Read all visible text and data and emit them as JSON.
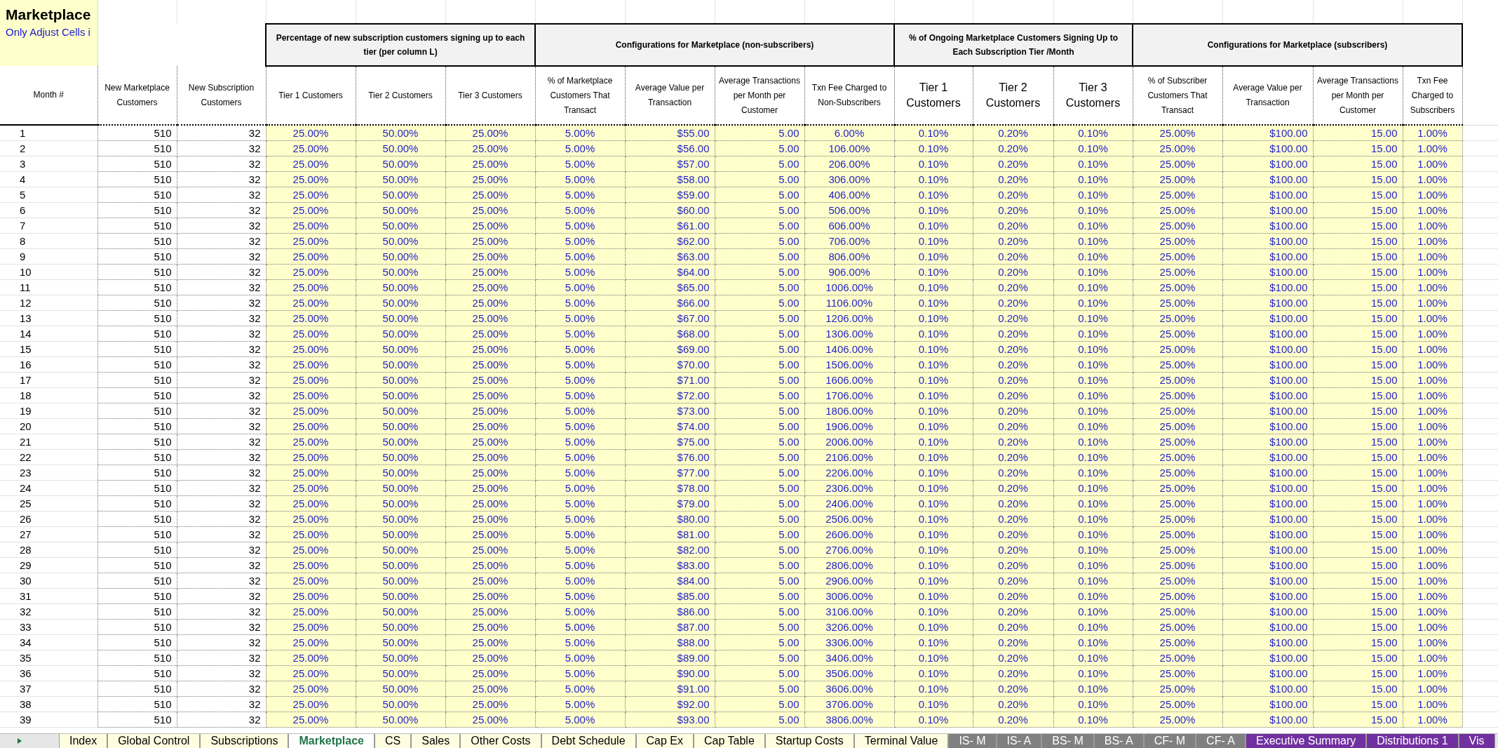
{
  "sheet": {
    "title": "Marketplace",
    "note": "Only Adjust Cells i"
  },
  "group_headers": [
    {
      "label": "Percentage of new subscription customers signing up to each tier (per column L)"
    },
    {
      "label": "Configurations for Marketplace (non-subscribers)"
    },
    {
      "label": "% of Ongoing Marketplace Customers Signing Up to Each Subscription Tier /Month"
    },
    {
      "label": "Configurations for Marketplace (subscribers)"
    }
  ],
  "columns": [
    "Month #",
    "New Marketplace Customers",
    "New Subscription Customers",
    "Tier 1 Customers",
    "Tier 2 Customers",
    "Tier 3 Customers",
    "% of Marketplace Customers That Transact",
    "Average Value per Transaction",
    "Average Transactions per Month per Customer",
    "Txn Fee Charged to Non-Subscribers",
    "Tier 1 Customers",
    "Tier 2 Customers",
    "Tier 3 Customers",
    "% of Subscriber Customers That Transact",
    "Average Value per Transaction",
    "Average Transactions per Month per Customer",
    "Txn Fee Charged to Subscribers"
  ],
  "rows": [
    [
      "1",
      "510",
      "32",
      "25.00%",
      "50.00%",
      "25.00%",
      "5.00%",
      "$55.00",
      "5.00",
      "6.00%",
      "0.10%",
      "0.20%",
      "0.10%",
      "25.00%",
      "$100.00",
      "15.00",
      "1.00%"
    ],
    [
      "2",
      "510",
      "32",
      "25.00%",
      "50.00%",
      "25.00%",
      "5.00%",
      "$56.00",
      "5.00",
      "106.00%",
      "0.10%",
      "0.20%",
      "0.10%",
      "25.00%",
      "$100.00",
      "15.00",
      "1.00%"
    ],
    [
      "3",
      "510",
      "32",
      "25.00%",
      "50.00%",
      "25.00%",
      "5.00%",
      "$57.00",
      "5.00",
      "206.00%",
      "0.10%",
      "0.20%",
      "0.10%",
      "25.00%",
      "$100.00",
      "15.00",
      "1.00%"
    ],
    [
      "4",
      "510",
      "32",
      "25.00%",
      "50.00%",
      "25.00%",
      "5.00%",
      "$58.00",
      "5.00",
      "306.00%",
      "0.10%",
      "0.20%",
      "0.10%",
      "25.00%",
      "$100.00",
      "15.00",
      "1.00%"
    ],
    [
      "5",
      "510",
      "32",
      "25.00%",
      "50.00%",
      "25.00%",
      "5.00%",
      "$59.00",
      "5.00",
      "406.00%",
      "0.10%",
      "0.20%",
      "0.10%",
      "25.00%",
      "$100.00",
      "15.00",
      "1.00%"
    ],
    [
      "6",
      "510",
      "32",
      "25.00%",
      "50.00%",
      "25.00%",
      "5.00%",
      "$60.00",
      "5.00",
      "506.00%",
      "0.10%",
      "0.20%",
      "0.10%",
      "25.00%",
      "$100.00",
      "15.00",
      "1.00%"
    ],
    [
      "7",
      "510",
      "32",
      "25.00%",
      "50.00%",
      "25.00%",
      "5.00%",
      "$61.00",
      "5.00",
      "606.00%",
      "0.10%",
      "0.20%",
      "0.10%",
      "25.00%",
      "$100.00",
      "15.00",
      "1.00%"
    ],
    [
      "8",
      "510",
      "32",
      "25.00%",
      "50.00%",
      "25.00%",
      "5.00%",
      "$62.00",
      "5.00",
      "706.00%",
      "0.10%",
      "0.20%",
      "0.10%",
      "25.00%",
      "$100.00",
      "15.00",
      "1.00%"
    ],
    [
      "9",
      "510",
      "32",
      "25.00%",
      "50.00%",
      "25.00%",
      "5.00%",
      "$63.00",
      "5.00",
      "806.00%",
      "0.10%",
      "0.20%",
      "0.10%",
      "25.00%",
      "$100.00",
      "15.00",
      "1.00%"
    ],
    [
      "10",
      "510",
      "32",
      "25.00%",
      "50.00%",
      "25.00%",
      "5.00%",
      "$64.00",
      "5.00",
      "906.00%",
      "0.10%",
      "0.20%",
      "0.10%",
      "25.00%",
      "$100.00",
      "15.00",
      "1.00%"
    ],
    [
      "11",
      "510",
      "32",
      "25.00%",
      "50.00%",
      "25.00%",
      "5.00%",
      "$65.00",
      "5.00",
      "1006.00%",
      "0.10%",
      "0.20%",
      "0.10%",
      "25.00%",
      "$100.00",
      "15.00",
      "1.00%"
    ],
    [
      "12",
      "510",
      "32",
      "25.00%",
      "50.00%",
      "25.00%",
      "5.00%",
      "$66.00",
      "5.00",
      "1106.00%",
      "0.10%",
      "0.20%",
      "0.10%",
      "25.00%",
      "$100.00",
      "15.00",
      "1.00%"
    ],
    [
      "13",
      "510",
      "32",
      "25.00%",
      "50.00%",
      "25.00%",
      "5.00%",
      "$67.00",
      "5.00",
      "1206.00%",
      "0.10%",
      "0.20%",
      "0.10%",
      "25.00%",
      "$100.00",
      "15.00",
      "1.00%"
    ],
    [
      "14",
      "510",
      "32",
      "25.00%",
      "50.00%",
      "25.00%",
      "5.00%",
      "$68.00",
      "5.00",
      "1306.00%",
      "0.10%",
      "0.20%",
      "0.10%",
      "25.00%",
      "$100.00",
      "15.00",
      "1.00%"
    ],
    [
      "15",
      "510",
      "32",
      "25.00%",
      "50.00%",
      "25.00%",
      "5.00%",
      "$69.00",
      "5.00",
      "1406.00%",
      "0.10%",
      "0.20%",
      "0.10%",
      "25.00%",
      "$100.00",
      "15.00",
      "1.00%"
    ],
    [
      "16",
      "510",
      "32",
      "25.00%",
      "50.00%",
      "25.00%",
      "5.00%",
      "$70.00",
      "5.00",
      "1506.00%",
      "0.10%",
      "0.20%",
      "0.10%",
      "25.00%",
      "$100.00",
      "15.00",
      "1.00%"
    ],
    [
      "17",
      "510",
      "32",
      "25.00%",
      "50.00%",
      "25.00%",
      "5.00%",
      "$71.00",
      "5.00",
      "1606.00%",
      "0.10%",
      "0.20%",
      "0.10%",
      "25.00%",
      "$100.00",
      "15.00",
      "1.00%"
    ],
    [
      "18",
      "510",
      "32",
      "25.00%",
      "50.00%",
      "25.00%",
      "5.00%",
      "$72.00",
      "5.00",
      "1706.00%",
      "0.10%",
      "0.20%",
      "0.10%",
      "25.00%",
      "$100.00",
      "15.00",
      "1.00%"
    ],
    [
      "19",
      "510",
      "32",
      "25.00%",
      "50.00%",
      "25.00%",
      "5.00%",
      "$73.00",
      "5.00",
      "1806.00%",
      "0.10%",
      "0.20%",
      "0.10%",
      "25.00%",
      "$100.00",
      "15.00",
      "1.00%"
    ],
    [
      "20",
      "510",
      "32",
      "25.00%",
      "50.00%",
      "25.00%",
      "5.00%",
      "$74.00",
      "5.00",
      "1906.00%",
      "0.10%",
      "0.20%",
      "0.10%",
      "25.00%",
      "$100.00",
      "15.00",
      "1.00%"
    ],
    [
      "21",
      "510",
      "32",
      "25.00%",
      "50.00%",
      "25.00%",
      "5.00%",
      "$75.00",
      "5.00",
      "2006.00%",
      "0.10%",
      "0.20%",
      "0.10%",
      "25.00%",
      "$100.00",
      "15.00",
      "1.00%"
    ],
    [
      "22",
      "510",
      "32",
      "25.00%",
      "50.00%",
      "25.00%",
      "5.00%",
      "$76.00",
      "5.00",
      "2106.00%",
      "0.10%",
      "0.20%",
      "0.10%",
      "25.00%",
      "$100.00",
      "15.00",
      "1.00%"
    ],
    [
      "23",
      "510",
      "32",
      "25.00%",
      "50.00%",
      "25.00%",
      "5.00%",
      "$77.00",
      "5.00",
      "2206.00%",
      "0.10%",
      "0.20%",
      "0.10%",
      "25.00%",
      "$100.00",
      "15.00",
      "1.00%"
    ],
    [
      "24",
      "510",
      "32",
      "25.00%",
      "50.00%",
      "25.00%",
      "5.00%",
      "$78.00",
      "5.00",
      "2306.00%",
      "0.10%",
      "0.20%",
      "0.10%",
      "25.00%",
      "$100.00",
      "15.00",
      "1.00%"
    ],
    [
      "25",
      "510",
      "32",
      "25.00%",
      "50.00%",
      "25.00%",
      "5.00%",
      "$79.00",
      "5.00",
      "2406.00%",
      "0.10%",
      "0.20%",
      "0.10%",
      "25.00%",
      "$100.00",
      "15.00",
      "1.00%"
    ],
    [
      "26",
      "510",
      "32",
      "25.00%",
      "50.00%",
      "25.00%",
      "5.00%",
      "$80.00",
      "5.00",
      "2506.00%",
      "0.10%",
      "0.20%",
      "0.10%",
      "25.00%",
      "$100.00",
      "15.00",
      "1.00%"
    ],
    [
      "27",
      "510",
      "32",
      "25.00%",
      "50.00%",
      "25.00%",
      "5.00%",
      "$81.00",
      "5.00",
      "2606.00%",
      "0.10%",
      "0.20%",
      "0.10%",
      "25.00%",
      "$100.00",
      "15.00",
      "1.00%"
    ],
    [
      "28",
      "510",
      "32",
      "25.00%",
      "50.00%",
      "25.00%",
      "5.00%",
      "$82.00",
      "5.00",
      "2706.00%",
      "0.10%",
      "0.20%",
      "0.10%",
      "25.00%",
      "$100.00",
      "15.00",
      "1.00%"
    ],
    [
      "29",
      "510",
      "32",
      "25.00%",
      "50.00%",
      "25.00%",
      "5.00%",
      "$83.00",
      "5.00",
      "2806.00%",
      "0.10%",
      "0.20%",
      "0.10%",
      "25.00%",
      "$100.00",
      "15.00",
      "1.00%"
    ],
    [
      "30",
      "510",
      "32",
      "25.00%",
      "50.00%",
      "25.00%",
      "5.00%",
      "$84.00",
      "5.00",
      "2906.00%",
      "0.10%",
      "0.20%",
      "0.10%",
      "25.00%",
      "$100.00",
      "15.00",
      "1.00%"
    ],
    [
      "31",
      "510",
      "32",
      "25.00%",
      "50.00%",
      "25.00%",
      "5.00%",
      "$85.00",
      "5.00",
      "3006.00%",
      "0.10%",
      "0.20%",
      "0.10%",
      "25.00%",
      "$100.00",
      "15.00",
      "1.00%"
    ],
    [
      "32",
      "510",
      "32",
      "25.00%",
      "50.00%",
      "25.00%",
      "5.00%",
      "$86.00",
      "5.00",
      "3106.00%",
      "0.10%",
      "0.20%",
      "0.10%",
      "25.00%",
      "$100.00",
      "15.00",
      "1.00%"
    ],
    [
      "33",
      "510",
      "32",
      "25.00%",
      "50.00%",
      "25.00%",
      "5.00%",
      "$87.00",
      "5.00",
      "3206.00%",
      "0.10%",
      "0.20%",
      "0.10%",
      "25.00%",
      "$100.00",
      "15.00",
      "1.00%"
    ],
    [
      "34",
      "510",
      "32",
      "25.00%",
      "50.00%",
      "25.00%",
      "5.00%",
      "$88.00",
      "5.00",
      "3306.00%",
      "0.10%",
      "0.20%",
      "0.10%",
      "25.00%",
      "$100.00",
      "15.00",
      "1.00%"
    ],
    [
      "35",
      "510",
      "32",
      "25.00%",
      "50.00%",
      "25.00%",
      "5.00%",
      "$89.00",
      "5.00",
      "3406.00%",
      "0.10%",
      "0.20%",
      "0.10%",
      "25.00%",
      "$100.00",
      "15.00",
      "1.00%"
    ],
    [
      "36",
      "510",
      "32",
      "25.00%",
      "50.00%",
      "25.00%",
      "5.00%",
      "$90.00",
      "5.00",
      "3506.00%",
      "0.10%",
      "0.20%",
      "0.10%",
      "25.00%",
      "$100.00",
      "15.00",
      "1.00%"
    ],
    [
      "37",
      "510",
      "32",
      "25.00%",
      "50.00%",
      "25.00%",
      "5.00%",
      "$91.00",
      "5.00",
      "3606.00%",
      "0.10%",
      "0.20%",
      "0.10%",
      "25.00%",
      "$100.00",
      "15.00",
      "1.00%"
    ],
    [
      "38",
      "510",
      "32",
      "25.00%",
      "50.00%",
      "25.00%",
      "5.00%",
      "$92.00",
      "5.00",
      "3706.00%",
      "0.10%",
      "0.20%",
      "0.10%",
      "25.00%",
      "$100.00",
      "15.00",
      "1.00%"
    ],
    [
      "39",
      "510",
      "32",
      "25.00%",
      "50.00%",
      "25.00%",
      "5.00%",
      "$93.00",
      "5.00",
      "3806.00%",
      "0.10%",
      "0.20%",
      "0.10%",
      "25.00%",
      "$100.00",
      "15.00",
      "1.00%"
    ]
  ],
  "tabs": [
    {
      "label": "Index",
      "selected": false,
      "color": "#fffde0"
    },
    {
      "label": "Global Control",
      "selected": false,
      "color": "#fffde0"
    },
    {
      "label": "Subscriptions",
      "selected": false,
      "color": "#fffde0"
    },
    {
      "label": "Marketplace",
      "selected": true,
      "color": "#ffffff"
    },
    {
      "label": "CS",
      "selected": false,
      "color": "#fffde0"
    },
    {
      "label": "Sales",
      "selected": false,
      "color": "#fffde0"
    },
    {
      "label": "Other Costs",
      "selected": false,
      "color": "#fffde0"
    },
    {
      "label": "Debt Schedule",
      "selected": false,
      "color": "#fffde0"
    },
    {
      "label": "Cap Ex",
      "selected": false,
      "color": "#fffde0"
    },
    {
      "label": "Cap Table",
      "selected": false,
      "color": "#fffde0"
    },
    {
      "label": "Startup Costs",
      "selected": false,
      "color": "#fffde0"
    },
    {
      "label": "Terminal Value",
      "selected": false,
      "color": "#fffde0"
    },
    {
      "label": "IS- M",
      "selected": false,
      "color": "#808080"
    },
    {
      "label": "IS- A",
      "selected": false,
      "color": "#808080"
    },
    {
      "label": "BS- M",
      "selected": false,
      "color": "#808080"
    },
    {
      "label": "BS- A",
      "selected": false,
      "color": "#808080"
    },
    {
      "label": "CF- M",
      "selected": false,
      "color": "#808080"
    },
    {
      "label": "CF- A",
      "selected": false,
      "color": "#808080"
    },
    {
      "label": "Executive Summary",
      "selected": false,
      "color": "#7030a0"
    },
    {
      "label": "Distributions 1",
      "selected": false,
      "color": "#7030a0"
    },
    {
      "label": "Vis",
      "selected": false,
      "color": "#7030a0"
    }
  ]
}
